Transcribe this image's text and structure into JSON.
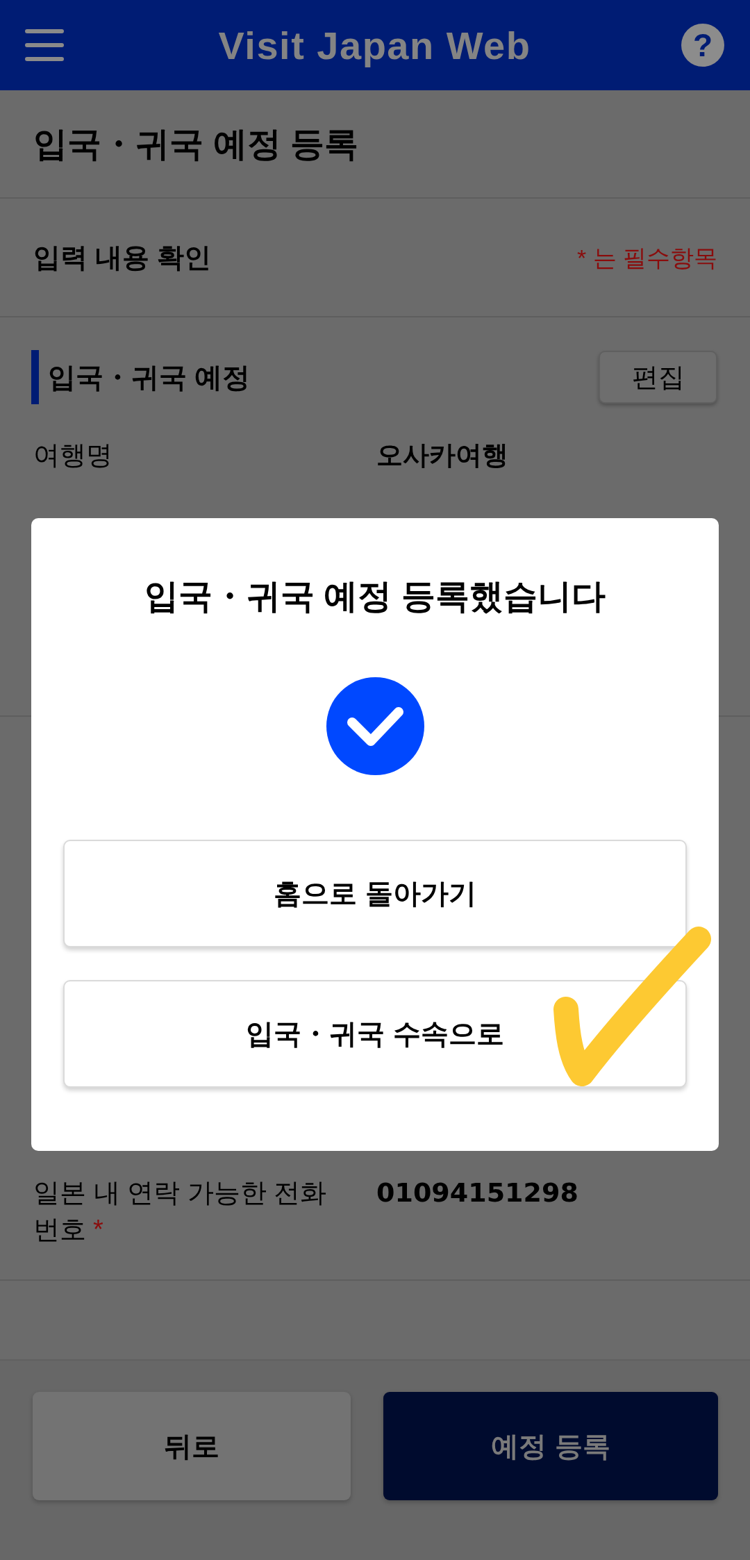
{
  "header": {
    "title": "Visit Japan Web",
    "help_label": "?"
  },
  "page_title": "입국・귀국 예정 등록",
  "confirm_bar": {
    "title": "입력 내용 확인",
    "required_legend": "* 는 필수항목"
  },
  "sections": [
    {
      "title": "입국・귀국 예정",
      "edit_button": "편집",
      "rows": [
        {
          "label": "여행명",
          "value": "오사카여행"
        }
      ]
    },
    {
      "rows": [
        {
          "label": "일본 내 연락 가능한 전화 번호",
          "required_mark": "*",
          "value": "01094151298"
        }
      ]
    }
  ],
  "dialog": {
    "title": "입국・귀국 예정 등록했습니다",
    "buttons": [
      "홈으로 돌아가기",
      "입국・귀국 수속으로"
    ]
  },
  "footer_buttons": [
    {
      "label": "뒤로",
      "kind": "secondary"
    },
    {
      "label": "예정 등록",
      "kind": "primary"
    }
  ]
}
